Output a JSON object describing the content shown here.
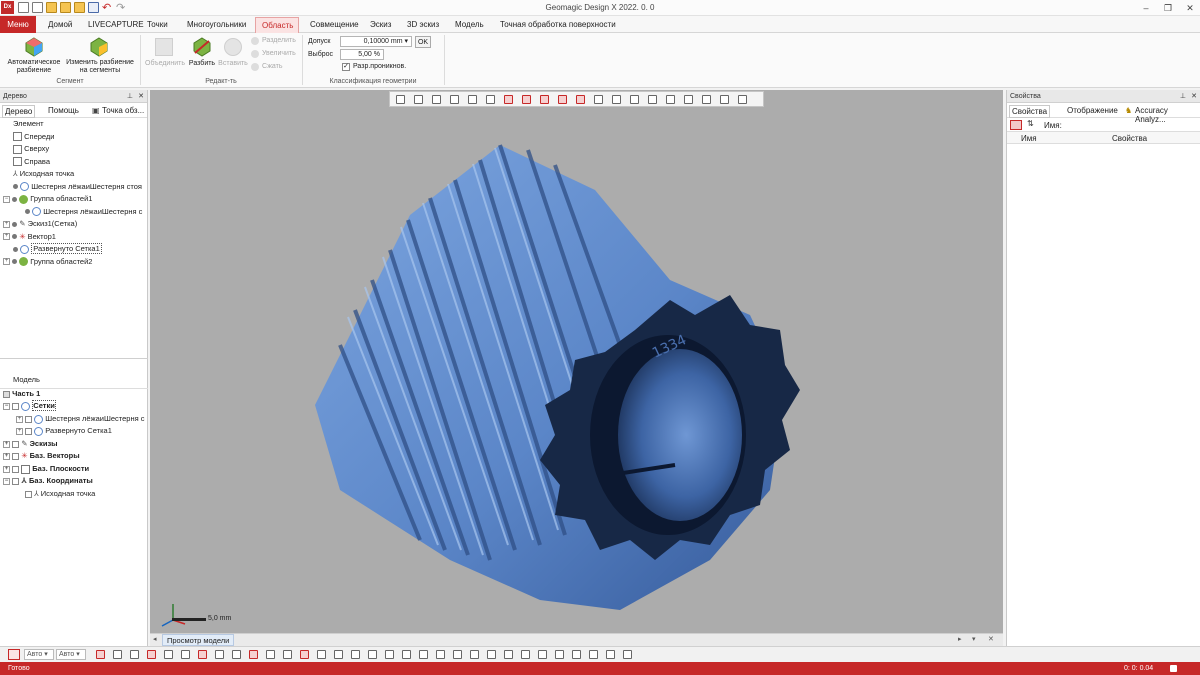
{
  "app": {
    "title": "Geomagic Design X 2022. 0. 0",
    "icon_text": "Dx"
  },
  "menubar": {
    "tabs": [
      "Меню",
      "Домой",
      "LIVECAPTURE",
      "Точки",
      "Многоугольники",
      "Область",
      "Совмещение",
      "Эскиз",
      "3D эскиз",
      "Модель",
      "Точная обработка поверхности"
    ],
    "active": "Область"
  },
  "ribbon": {
    "segment": {
      "label": "Сегмент",
      "auto_line1": "Автоматическое",
      "auto_line2": "разбиение",
      "change_line1": "Изменить разбиение",
      "change_line2": "на сегменты"
    },
    "edit": {
      "label": "Редакт-ть",
      "merge": "Объединить",
      "split": "Разбить",
      "insert": "Вставить",
      "divide": "Разделить",
      "grow": "Увеличить",
      "shrink": "Сжать"
    },
    "classify": {
      "label": "Классификация геометрии",
      "tolerance_label": "Допуск",
      "tolerance_value": "0,10000 mm",
      "ok": "OK",
      "outlier_label": "Выброс",
      "outlier_value": "5,00 %",
      "allow_penetration": "Разр.проникнов."
    }
  },
  "tree": {
    "header": "Дерево",
    "tabs": [
      "Дерево",
      "Помощь",
      "Точка обз..."
    ],
    "feature_header": "Элемент",
    "items": [
      "Спереди",
      "Сверху",
      "Справа",
      "Исходная точка",
      "Шестерня лёжаиШестерня стоя",
      "Группа областей1",
      "Шестерня лёжаиШестерня с",
      "Эскиз1(Сетка)",
      "Вектор1",
      "Развернуто Сетка1",
      "Группа областей2"
    ],
    "model_header": "Модель",
    "model_items": [
      "Часть 1",
      "Сетки",
      "Шестерня лёжаиШестерня с",
      "Развернуто Сетка1",
      "Эскизы",
      "Баз. Векторы",
      "Баз. Плоскости",
      "Баз. Координаты",
      "Исходная точка"
    ],
    "bottom_auto1": "Авто",
    "bottom_auto2": "Авто"
  },
  "viewport": {
    "scale_label": "5,0 mm",
    "view_tab": "Просмотр модели",
    "part_marking": "1334"
  },
  "properties": {
    "header": "Свойства",
    "tabs": [
      "Свойства",
      "Отображение",
      "Accuracy Analyz..."
    ],
    "name_label": "Имя:",
    "col_name": "Имя",
    "col_props": "Свойства"
  },
  "status": {
    "ready": "Готово",
    "time": "0: 0: 0.04"
  },
  "colors": {
    "accent": "#c62828",
    "mesh": "#5b86c8",
    "viewport": "#acacac"
  }
}
